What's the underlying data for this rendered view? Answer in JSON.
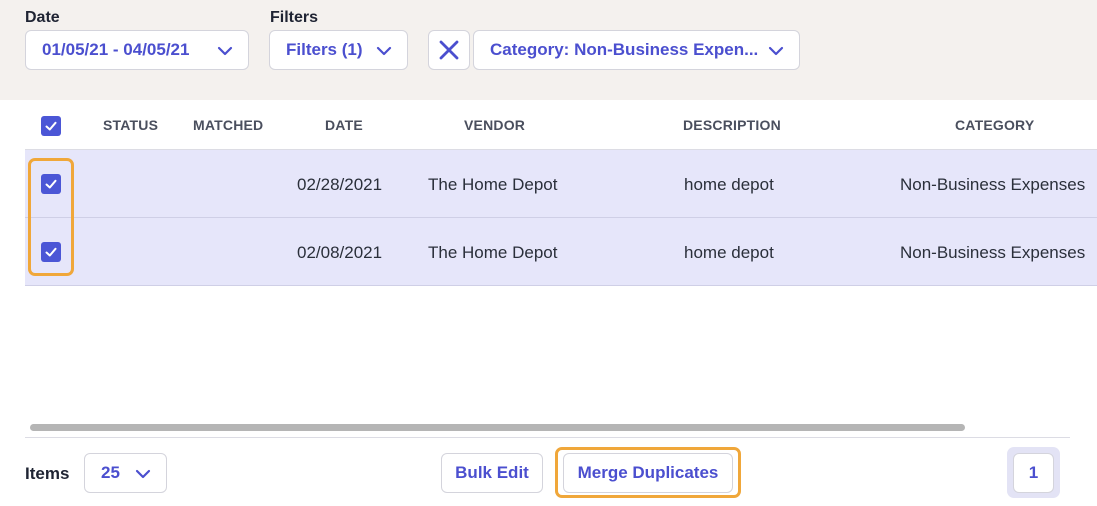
{
  "filters": {
    "date_label": "Date",
    "date_value": "01/05/21 - 04/05/21",
    "filters_label": "Filters",
    "filters_value": "Filters (1)",
    "category_value": "Category: Non-Business Expen..."
  },
  "table": {
    "headers": {
      "status": "STATUS",
      "matched": "MATCHED",
      "date": "DATE",
      "vendor": "VENDOR",
      "description": "DESCRIPTION",
      "category": "CATEGORY"
    },
    "rows": [
      {
        "checked": true,
        "status": "",
        "matched": "",
        "date": "02/28/2021",
        "vendor": "The Home Depot",
        "description": "home depot",
        "category": "Non-Business Expenses"
      },
      {
        "checked": true,
        "status": "",
        "matched": "",
        "date": "02/08/2021",
        "vendor": "The Home Depot",
        "description": "home depot",
        "category": "Non-Business Expenses"
      }
    ]
  },
  "footer": {
    "items_label": "Items",
    "items_per_page": "25",
    "bulk_edit_label": "Bulk Edit",
    "merge_label": "Merge Duplicates",
    "page_number": "1"
  },
  "colors": {
    "accent": "#4b4fcf",
    "checkbox": "#4b56d6",
    "selected_row": "#e6e6fa",
    "highlight": "#f0a73a",
    "filter_bar_bg": "#f4f1ee"
  }
}
